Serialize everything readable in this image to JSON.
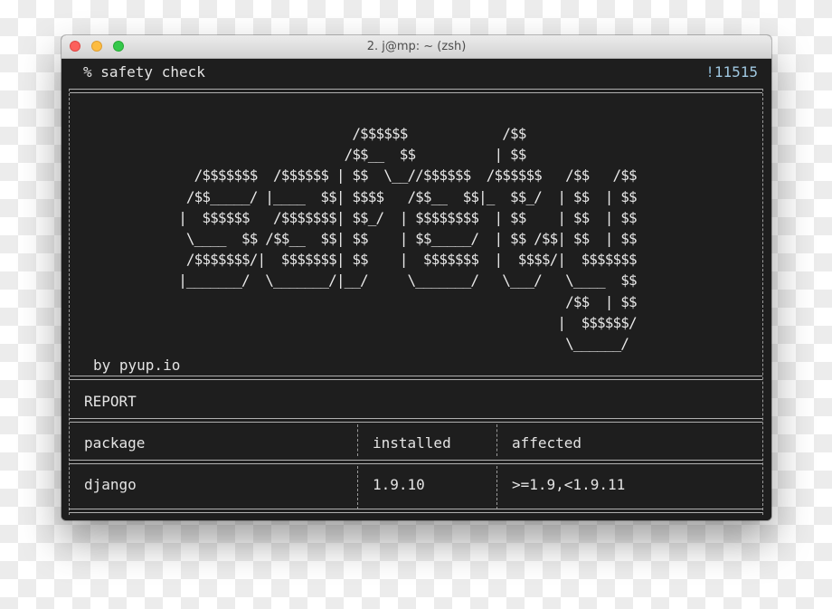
{
  "window": {
    "title": "2. j@mp: ~ (zsh)"
  },
  "terminal": {
    "prompt": "% safety check",
    "history_prefix": "!",
    "history_number": "11515",
    "logo_ascii": "                         /$$$$$$            /$$\n                        /$$__  $$          | $$\n     /$$$$$$$  /$$$$$$ | $$  \\__//$$$$$$  /$$$$$$   /$$   /$$\n    /$$_____/ |____  $$| $$$$   /$$__  $$|_  $$_/  | $$  | $$\n   |  $$$$$$   /$$$$$$$| $$_/  | $$$$$$$$  | $$    | $$  | $$\n    \\____  $$ /$$__  $$| $$    | $$_____/  | $$ /$$| $$  | $$\n    /$$$$$$$/|  $$$$$$$| $$    |  $$$$$$$  |  $$$$/|  $$$$$$$\n   |_______/  \\_______/|__/     \\_______/   \\___/   \\____  $$\n                                                    /$$  | $$\n                                                   |  $$$$$$/\n                                                    \\______/",
    "byline": "by pyup.io",
    "report_heading": "REPORT",
    "table": {
      "headers": [
        "package",
        "installed",
        "affected"
      ],
      "rows": [
        [
          "django",
          "1.9.10",
          ">=1.9,<1.9.11"
        ]
      ]
    }
  }
}
